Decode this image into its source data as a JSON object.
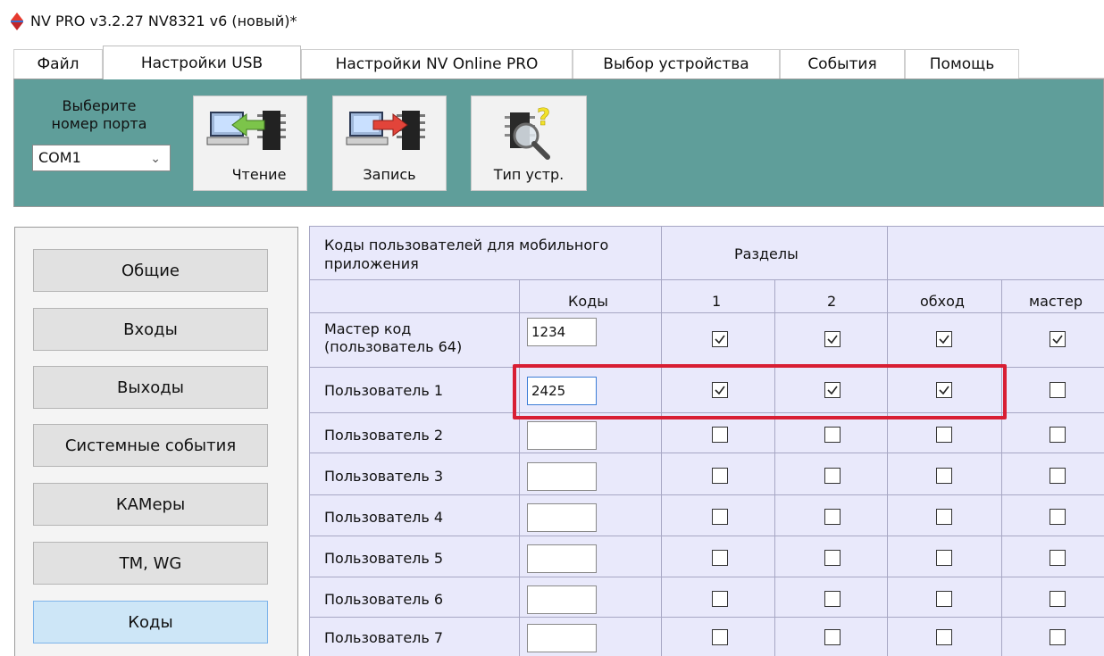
{
  "window": {
    "title": "NV PRO v3.2.27 NV8321 v6 (новый)*"
  },
  "tabs": [
    {
      "label": "Файл"
    },
    {
      "label": "Настройки USB"
    },
    {
      "label": "Настройки NV Online PRO"
    },
    {
      "label": "Выбор устройства"
    },
    {
      "label": "События"
    },
    {
      "label": "Помощь"
    }
  ],
  "active_tab": "Настройки USB",
  "toolbar": {
    "port_label": "Выберите номер порта",
    "port_value": "COM1",
    "read_label": "Чтение",
    "write_label": "Запись",
    "device_type_label": "Тип устр."
  },
  "nav": {
    "items": [
      {
        "label": "Общие"
      },
      {
        "label": "Входы"
      },
      {
        "label": "Выходы"
      },
      {
        "label": "Системные события"
      },
      {
        "label": "КАМеры"
      },
      {
        "label": "TM, WG"
      },
      {
        "label": "Коды"
      }
    ],
    "active": "Коды"
  },
  "table": {
    "title": "Коды пользователей для мобильного приложения",
    "group_header": "Разделы",
    "col_codes": "Коды",
    "col_1": "1",
    "col_2": "2",
    "col_bypass": "обход",
    "col_master": "мастер",
    "rows": [
      {
        "name": "Мастер код (пользователь 64)",
        "code": "1234",
        "p1": true,
        "p2": true,
        "bypass": true,
        "master": true
      },
      {
        "name": "Пользователь 1",
        "code": "2425",
        "p1": true,
        "p2": true,
        "bypass": true,
        "master": false
      },
      {
        "name": "Пользователь 2",
        "code": "",
        "p1": false,
        "p2": false,
        "bypass": false,
        "master": false
      },
      {
        "name": "Пользователь 3",
        "code": "",
        "p1": false,
        "p2": false,
        "bypass": false,
        "master": false
      },
      {
        "name": "Пользователь 4",
        "code": "",
        "p1": false,
        "p2": false,
        "bypass": false,
        "master": false
      },
      {
        "name": "Пользователь 5",
        "code": "",
        "p1": false,
        "p2": false,
        "bypass": false,
        "master": false
      },
      {
        "name": "Пользователь 6",
        "code": "",
        "p1": false,
        "p2": false,
        "bypass": false,
        "master": false
      },
      {
        "name": "Пользователь 7",
        "code": "",
        "p1": false,
        "p2": false,
        "bypass": false,
        "master": false
      }
    ]
  },
  "colors": {
    "toolbar_bg": "#5f9e9a",
    "grid_bg": "#e9e9fb",
    "highlight": "#d81e33",
    "active_nav": "#cde6f7"
  },
  "icons": [
    "app-logo-icon",
    "pc-to-chip-read-icon",
    "pc-to-chip-write-icon",
    "chip-magnifier-icon",
    "checkmark-icon",
    "chevron-down-icon"
  ]
}
